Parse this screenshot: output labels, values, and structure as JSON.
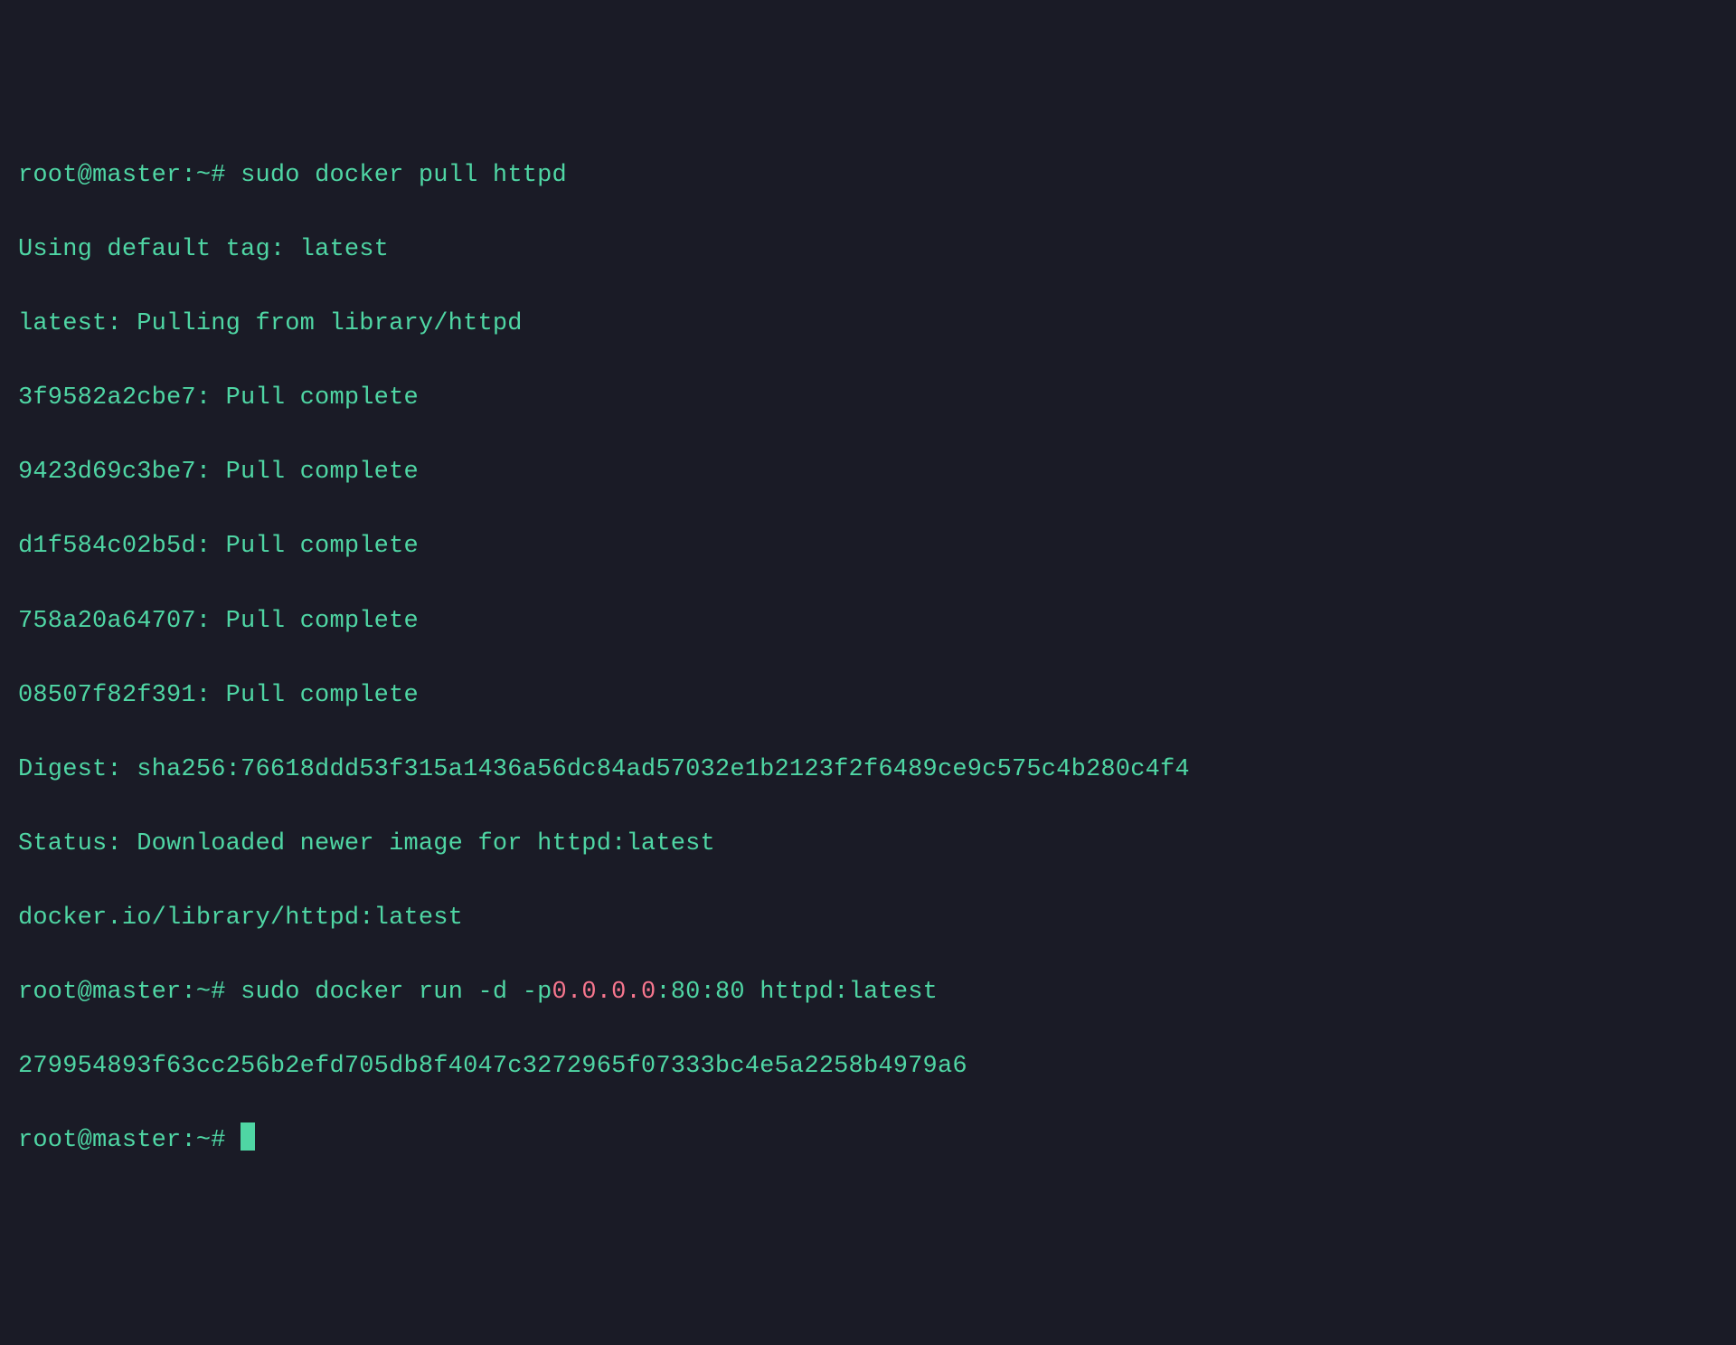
{
  "prompt": {
    "user": "root",
    "host": "master",
    "cwd": "~",
    "sep_user_host": "@",
    "sep_host_cwd": ":",
    "prompt_char": "#"
  },
  "cmd1": "sudo docker pull httpd",
  "out1": {
    "using_default_tag": "Using default tag: latest",
    "pulling_from": "latest: Pulling from library/httpd",
    "layers": [
      "3f9582a2cbe7: Pull complete",
      "9423d69c3be7: Pull complete",
      "d1f584c02b5d: Pull complete",
      "758a20a64707: Pull complete",
      "08507f82f391: Pull complete"
    ],
    "digest": "Digest: sha256:76618ddd53f315a1436a56dc84ad57032e1b2123f2f6489ce9c575c4b280c4f4",
    "status": "Status: Downloaded newer image for httpd:latest",
    "image_ref": "docker.io/library/httpd:latest"
  },
  "cmd2": {
    "pre": "sudo docker run -d -p",
    "addr": "0.0.0.0",
    "post": ":80:80 httpd:latest"
  },
  "out2": {
    "container_id": "279954893f63cc256b2efd705db8f4047c3272965f07333bc4e5a2258b4979a6"
  }
}
